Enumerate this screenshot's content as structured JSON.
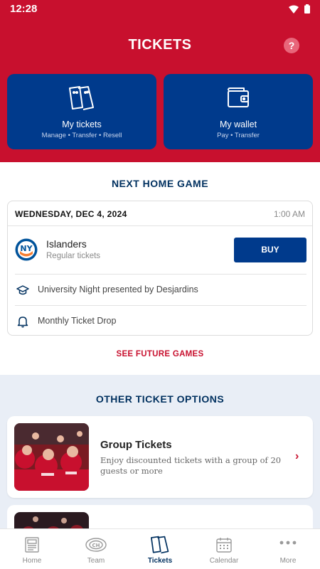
{
  "status_bar": {
    "time": "12:28"
  },
  "header": {
    "title": "TICKETS",
    "help_label": "?"
  },
  "tiles": [
    {
      "title": "My tickets",
      "subtitle": "Manage • Transfer • Resell",
      "icon": "tickets-icon"
    },
    {
      "title": "My wallet",
      "subtitle": "Pay • Transfer",
      "icon": "wallet-icon"
    }
  ],
  "next_game": {
    "section_title": "NEXT HOME GAME",
    "date": "WEDNESDAY, DEC 4, 2024",
    "time": "1:00 AM",
    "opponent": "Islanders",
    "ticket_type": "Regular tickets",
    "buy_label": "BUY",
    "promos": [
      {
        "label": "University Night presented by Desjardins",
        "icon": "graduation-cap-icon"
      },
      {
        "label": "Monthly Ticket Drop",
        "icon": "bell-icon"
      }
    ]
  },
  "future_games_link": "SEE FUTURE GAMES",
  "other_options": {
    "section_title": "OTHER TICKET OPTIONS",
    "items": [
      {
        "title": "Group Tickets",
        "description": "Enjoy discounted tickets with a group of 20 guests or more"
      }
    ]
  },
  "bottom_nav": {
    "items": [
      {
        "label": "Home",
        "icon": "news-icon"
      },
      {
        "label": "Team",
        "icon": "team-logo-icon"
      },
      {
        "label": "Tickets",
        "icon": "tickets-icon"
      },
      {
        "label": "Calendar",
        "icon": "calendar-icon"
      },
      {
        "label": "More",
        "icon": "more-dots-icon"
      }
    ],
    "active": "Tickets"
  },
  "colors": {
    "brand_red": "#c8102e",
    "brand_blue": "#003a8c",
    "navy_text": "#00305f"
  }
}
